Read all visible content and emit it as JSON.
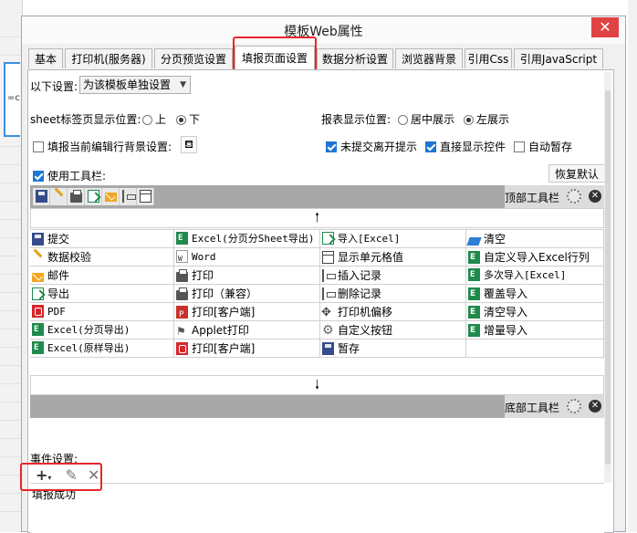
{
  "dialog": {
    "title": "模板Web属性",
    "close_glyph": "✕"
  },
  "background": {
    "cell_text": "=c"
  },
  "tabs": [
    {
      "label": "基本"
    },
    {
      "label": "打印机(服务器)"
    },
    {
      "label": "分页预览设置"
    },
    {
      "label": "填报页面设置"
    },
    {
      "label": "数据分析设置"
    },
    {
      "label": "浏览器背景"
    },
    {
      "label": "引用Css"
    },
    {
      "label": "引用JavaScript"
    }
  ],
  "settings": {
    "scope_label": "以下设置:",
    "scope_value": "为该模板单独设置",
    "sheet_tab_label": "sheet标签页显示位置:",
    "sheet_top": "上",
    "sheet_bottom": "下",
    "report_pos_label": "报表显示位置:",
    "report_center": "居中展示",
    "report_left": "左展示",
    "bg_row_label": "填报当前编辑行背景设置:",
    "unsubmitted_label": "未提交离开提示",
    "direct_control_label": "直接显示控件",
    "autosave_label": "自动暂存",
    "use_toolbar_label": "使用工具栏:",
    "reset_button": "恢复默认"
  },
  "toolbar": {
    "top_label": "顶部工具栏",
    "bottom_label": "底部工具栏",
    "up_arrow": "🠑",
    "down_arrow": "🠓"
  },
  "buttons": [
    [
      "提交",
      "Excel(分页分Sheet导出)",
      "导入[Excel]",
      "清空"
    ],
    [
      "数据校验",
      "Word",
      "显示单元格值",
      "自定义导入Excel行列"
    ],
    [
      "邮件",
      "打印",
      "插入记录",
      "多次导入[Excel]"
    ],
    [
      "导出",
      "打印（兼容）",
      "删除记录",
      "覆盖导入"
    ],
    [
      "PDF",
      "打印[客户端]",
      "打印机偏移",
      "清空导入"
    ],
    [
      "Excel(分页导出)",
      "Applet打印",
      "自定义按钮",
      "增量导入"
    ],
    [
      "Excel(原样导出)",
      "打印[客户端]",
      "暂存",
      ""
    ]
  ],
  "events": {
    "label": "事件设置:",
    "add_glyph": "+",
    "edit_glyph": "✎",
    "delete_glyph": "✕",
    "items": [
      "填报成功"
    ]
  },
  "colors": {
    "highlight": "#e8262a",
    "accent": "#1e76d2",
    "close": "#e04343"
  }
}
